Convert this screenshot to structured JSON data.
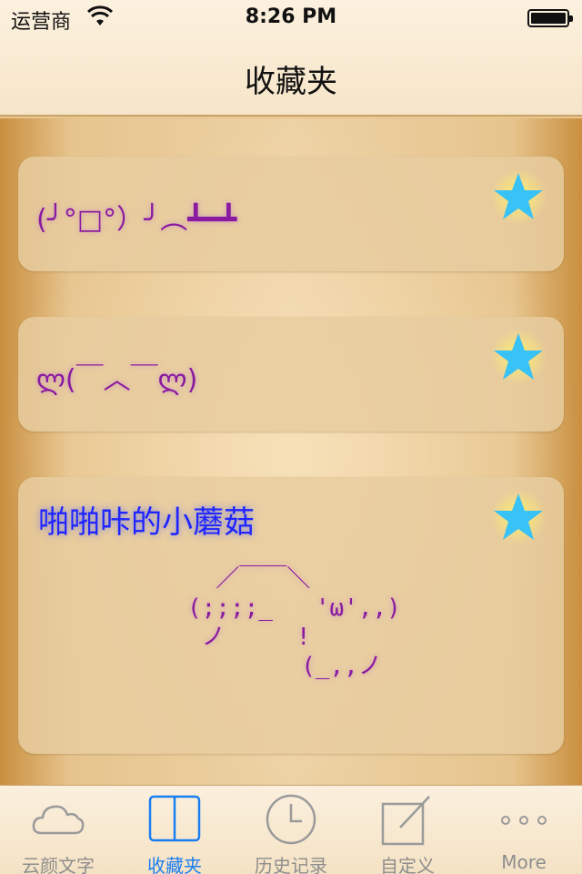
{
  "status_bar": {
    "carrier": "运营商",
    "time": "8:26 PM"
  },
  "nav": {
    "title": "收藏夹"
  },
  "favorites": [
    {
      "text": "(╯°□°）╯︵┻━┻",
      "starred": true
    },
    {
      "text": "ლ(￣︿￣ლ)",
      "starred": true
    },
    {
      "title": "啪啪咔的小蘑菇",
      "ascii": "  ／￣￣＼\n(;;;;_   'ω',,)\n ノ     !\n        (_,,ノ",
      "starred": true
    }
  ],
  "tabs": [
    {
      "label": "云颜文字",
      "icon": "cloud-icon"
    },
    {
      "label": "收藏夹",
      "icon": "book-icon",
      "active": true
    },
    {
      "label": "历史记录",
      "icon": "clock-icon"
    },
    {
      "label": "自定义",
      "icon": "compose-icon"
    },
    {
      "label": "More",
      "icon": "more-icon"
    }
  ],
  "colors": {
    "accent": "#1a7ef2",
    "emoticon": "#8a1aa0",
    "title_blue": "#1f25ff",
    "star": "#38c2f5"
  }
}
